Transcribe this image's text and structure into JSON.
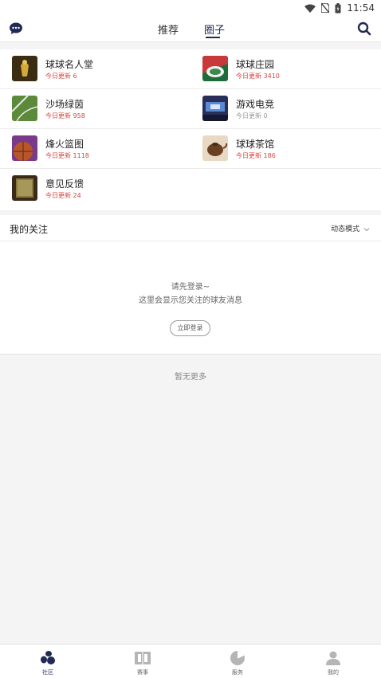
{
  "status_bar": {
    "time": "11:54"
  },
  "nav": {
    "tabs": [
      {
        "label": "推荐"
      },
      {
        "label": "圈子"
      }
    ]
  },
  "circles": [
    {
      "name": "球球名人堂",
      "update": "今日更新 6",
      "thumb_color": "#3a2d12"
    },
    {
      "name": "球球庄园",
      "update": "今日更新 3410",
      "thumb_color": "#1f6b3a"
    },
    {
      "name": "沙场绿茵",
      "update": "今日更新 958",
      "thumb_color": "#5c8a3a"
    },
    {
      "name": "游戏电竞",
      "update": "今日更新 0",
      "thumb_color": "#2a2f5a"
    },
    {
      "name": "烽火篮图",
      "update": "今日更新 1118",
      "thumb_color": "#b8562a"
    },
    {
      "name": "球球茶馆",
      "update": "今日更新 186",
      "thumb_color": "#6a4022"
    },
    {
      "name": "意见反馈",
      "update": "今日更新 24",
      "thumb_color": "#8a7a3a"
    }
  ],
  "follow": {
    "title": "我的关注",
    "mode_label": "动态模式"
  },
  "login": {
    "tip1": "请先登录~",
    "tip2": "这里会显示您关注的球友消息",
    "button": "立即登录"
  },
  "nomore": "暂无更多",
  "tabbar": [
    {
      "label": "社区"
    },
    {
      "label": "赛事"
    },
    {
      "label": "服务"
    },
    {
      "label": "我的"
    }
  ],
  "colors": {
    "accent": "#1f2a55",
    "update_red": "#d6463f"
  }
}
